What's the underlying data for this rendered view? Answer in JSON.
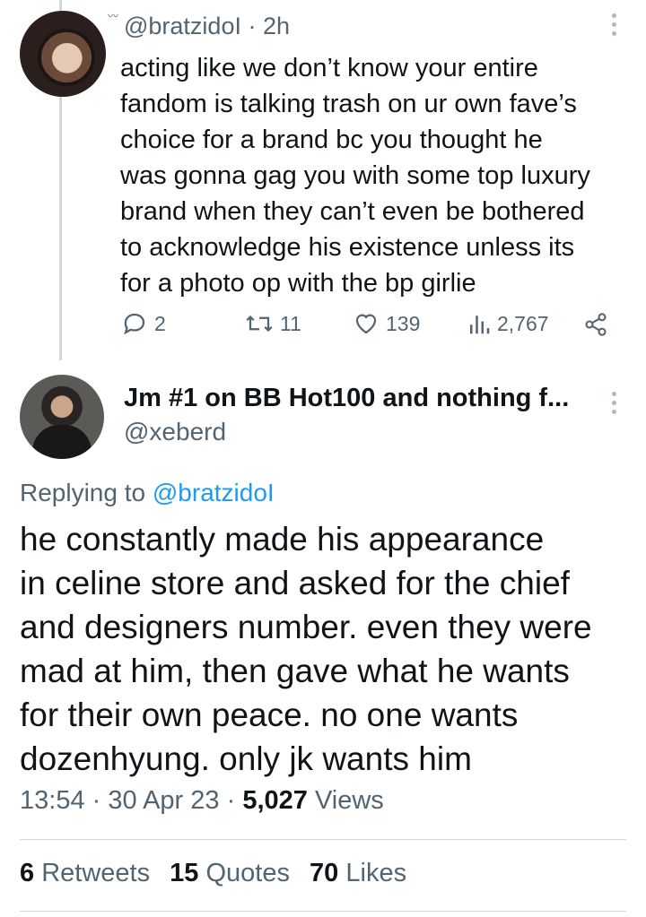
{
  "tweet1": {
    "handle": "@bratzidoI",
    "separator": "·",
    "time": "2h",
    "text": "acting like we don’t know your entire\nfandom is talking trash on ur own fave’s\nchoice for a brand bc you thought he\nwas gonna gag you with some top luxury\nbrand when they can’t even be bothered\nto acknowledge his existence unless its\nfor a photo op with the bp girlie",
    "replies": "2",
    "retweets": "11",
    "likes": "139",
    "views": "2,767",
    "icons": [
      "reply-icon",
      "retweet-icon",
      "like-icon",
      "views-icon",
      "share-icon",
      "more-icon"
    ]
  },
  "tweet2": {
    "name": "Jm #1 on BB Hot100 and nothing f...",
    "handle": "@xeberd",
    "replying_prefix": "Replying to ",
    "replying_handle": "@bratzidoI",
    "text": "he constantly made his appearance\nin celine store and asked for the chief\nand designers number. even they were\nmad at him, then gave what he wants\nfor their own peace. no one wants\ndozenhyung. only jk wants him",
    "time": "13:54",
    "date": "30 Apr 23",
    "views_count": "5,027",
    "views_label": "Views",
    "separator": "·",
    "retweets_count": "6",
    "retweets_label": "Retweets",
    "quotes_count": "15",
    "quotes_label": "Quotes",
    "likes_count": "70",
    "likes_label": "Likes"
  },
  "colors": {
    "text": "#0f1419",
    "secondary": "#536471",
    "link": "#1d9bf0",
    "border": "#cfd9de"
  }
}
